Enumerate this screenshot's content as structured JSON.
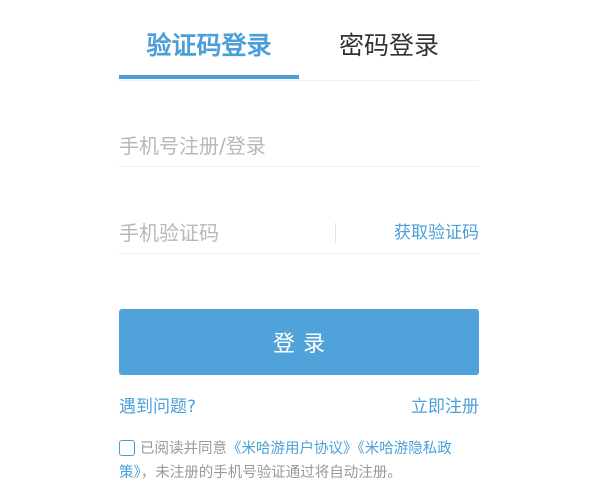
{
  "tabs": {
    "sms_login": "验证码登录",
    "password_login": "密码登录"
  },
  "form": {
    "phone_placeholder": "手机号注册/登录",
    "code_placeholder": "手机验证码",
    "get_code_label": "获取验证码",
    "login_button": "登录"
  },
  "links": {
    "help": "遇到问题?",
    "register": "立即注册"
  },
  "agreement": {
    "prefix": "已阅读并同意",
    "user_agreement": "《米哈游用户协议》",
    "privacy_policy": "《米哈游隐私政策》",
    "suffix": "，未注册的手机号验证通过将自动注册。"
  },
  "colors": {
    "accent": "#4a9fd8",
    "button": "#4fa3da",
    "placeholder": "#b8b8b8",
    "muted_text": "#999999"
  }
}
